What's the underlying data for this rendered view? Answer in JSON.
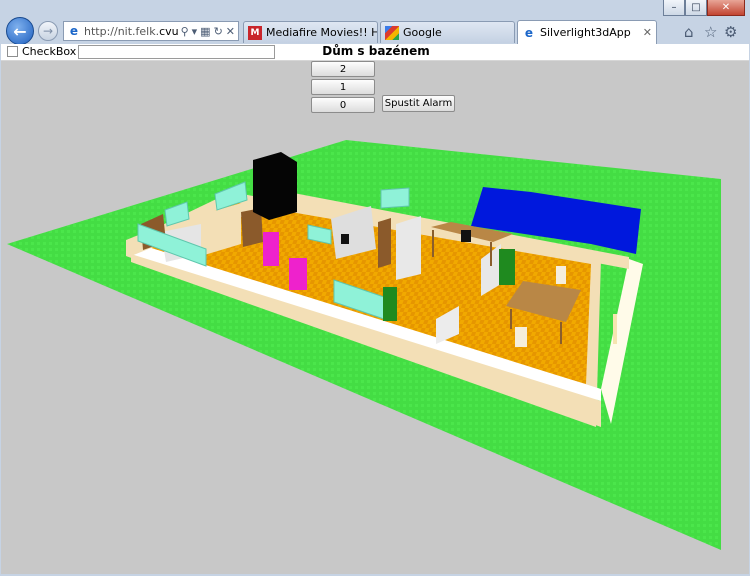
{
  "browser": {
    "address_url_prefix": "http://nit.felk.",
    "address_url_domain": "cvut...",
    "tabs": [
      {
        "label": "Mediafire Movies!! High ...",
        "icon": "mediafire-icon"
      },
      {
        "label": "Google",
        "icon": "google-icon"
      },
      {
        "label": "Silverlight3dApp",
        "icon": "ie-page-icon",
        "active": true
      }
    ],
    "colors": {
      "chrome": "#c6d3e4",
      "back_button": "#1e5fbf"
    }
  },
  "app": {
    "checkbox_label": "CheckBox",
    "checkbox_checked": false,
    "textbox_value": "",
    "title": "Dům s bazénem",
    "floor_buttons": [
      "2",
      "1",
      "0"
    ],
    "alarm_button": "Spustit Alarm"
  },
  "scene": {
    "colors": {
      "background": "#c8c8c8",
      "grass": "#44dd44",
      "floor": "#f1a900",
      "wall": "#f3dfb6",
      "pool": "#0018dd",
      "door": "#8b5a2b",
      "table": "#b98746",
      "window": "#8ff2d8",
      "appliance_pink": "#ee22cc",
      "appliance_green": "#1f8a1f"
    }
  }
}
